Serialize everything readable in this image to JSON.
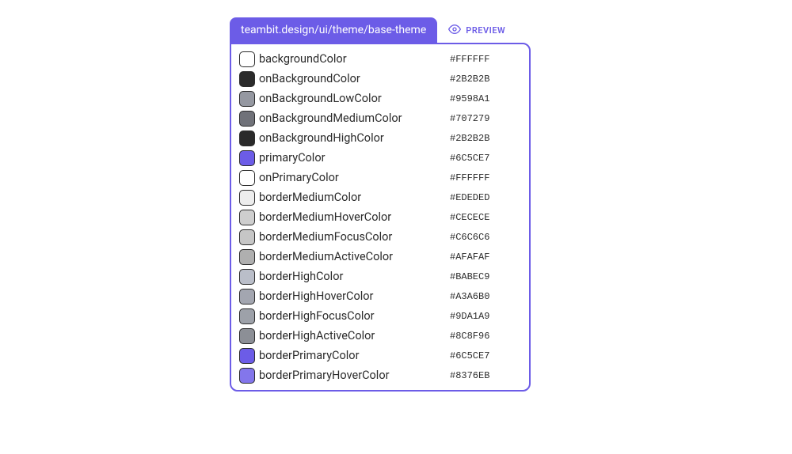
{
  "header": {
    "path": "teambit.design/ui/theme/base-theme",
    "preview_label": "PREVIEW"
  },
  "tokens": [
    {
      "name": "backgroundColor",
      "value": "#FFFFFF",
      "swatch": "#FFFFFF"
    },
    {
      "name": "onBackgroundColor",
      "value": "#2B2B2B",
      "swatch": "#2B2B2B"
    },
    {
      "name": "onBackgroundLowColor",
      "value": "#9598A1",
      "swatch": "#9598A1"
    },
    {
      "name": "onBackgroundMediumColor",
      "value": "#707279",
      "swatch": "#707279"
    },
    {
      "name": "onBackgroundHighColor",
      "value": "#2B2B2B",
      "swatch": "#2B2B2B"
    },
    {
      "name": "primaryColor",
      "value": "#6C5CE7",
      "swatch": "#6C5CE7"
    },
    {
      "name": "onPrimaryColor",
      "value": "#FFFFFF",
      "swatch": "#FFFFFF"
    },
    {
      "name": "borderMediumColor",
      "value": "#EDEDED",
      "swatch": "#EDEDED"
    },
    {
      "name": "borderMediumHoverColor",
      "value": "#CECECE",
      "swatch": "#CECECE"
    },
    {
      "name": "borderMediumFocusColor",
      "value": "#C6C6C6",
      "swatch": "#C6C6C6"
    },
    {
      "name": "borderMediumActiveColor",
      "value": "#AFAFAF",
      "swatch": "#AFAFAF"
    },
    {
      "name": "borderHighColor",
      "value": "#BABEC9",
      "swatch": "#BABEC9"
    },
    {
      "name": "borderHighHoverColor",
      "value": "#A3A6B0",
      "swatch": "#A3A6B0"
    },
    {
      "name": "borderHighFocusColor",
      "value": "#9DA1A9",
      "swatch": "#9DA1A9"
    },
    {
      "name": "borderHighActiveColor",
      "value": "#8C8F96",
      "swatch": "#8C8F96"
    },
    {
      "name": "borderPrimaryColor",
      "value": "#6C5CE7",
      "swatch": "#6C5CE7"
    },
    {
      "name": "borderPrimaryHoverColor",
      "value": "#8376EB",
      "swatch": "#8376EB"
    }
  ]
}
